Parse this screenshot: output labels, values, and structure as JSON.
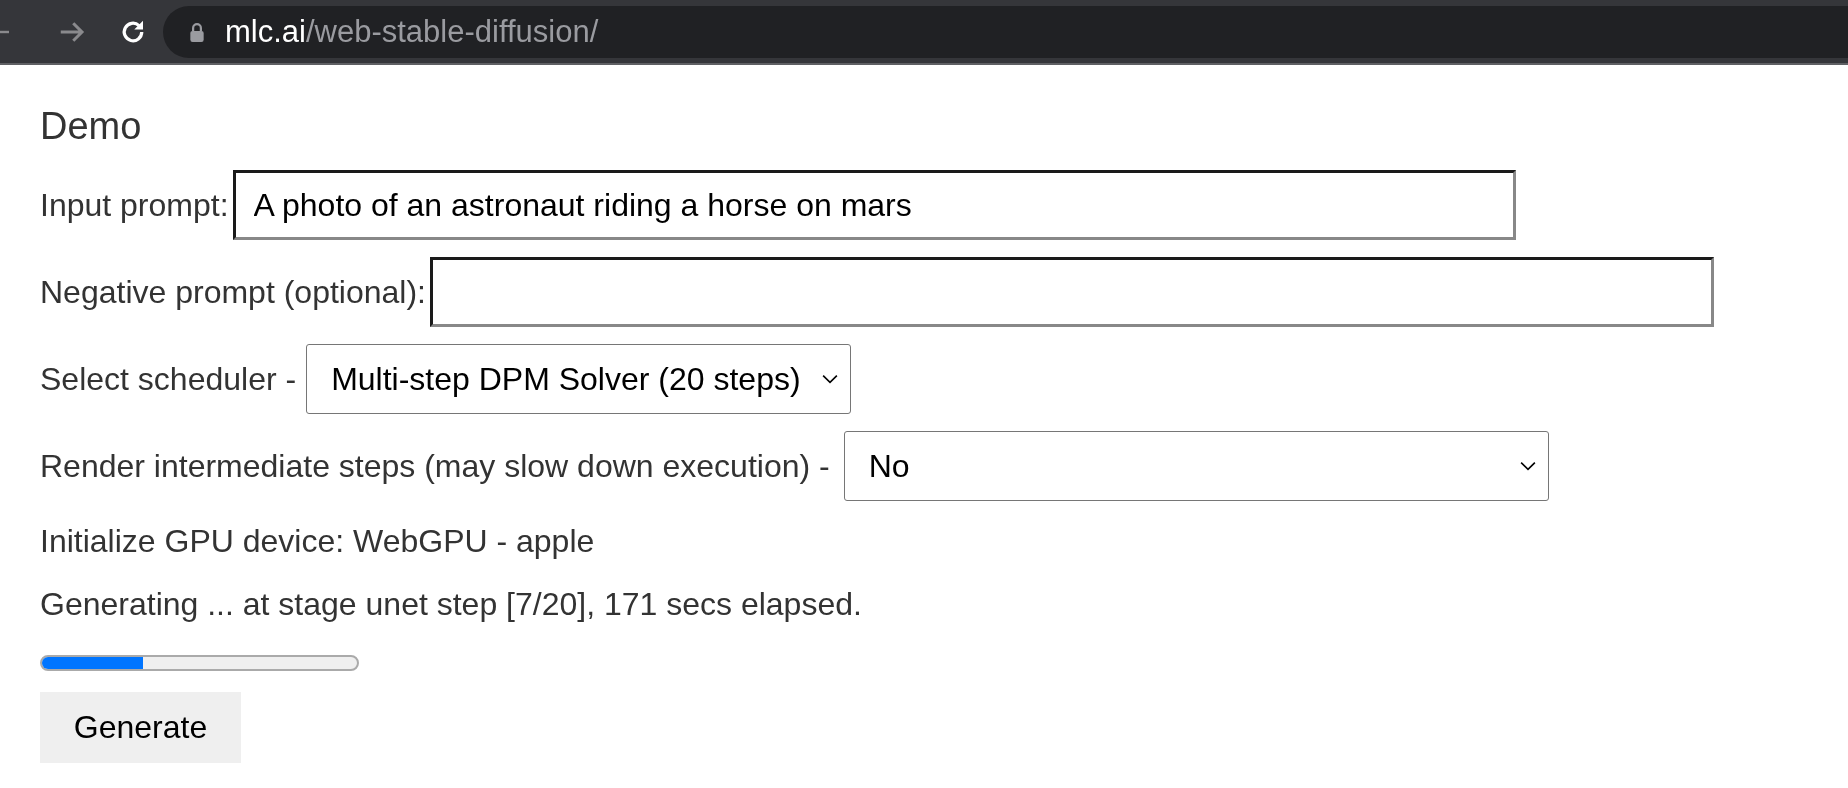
{
  "browser": {
    "url_host": "mlc.ai",
    "url_path": "/web-stable-diffusion/"
  },
  "heading": "Demo",
  "fields": [
    {
      "kind": "text",
      "label": "Input prompt:",
      "value": "A photo of an astronaut riding a horse on mars"
    },
    {
      "kind": "text",
      "label": "Negative prompt (optional):"
    },
    {
      "kind": "select",
      "label": "Select scheduler -",
      "value": "Multi-step DPM Solver (20 steps)"
    },
    {
      "kind": "select",
      "label": "Render intermediate steps (may slow down execution) -",
      "value": "No"
    }
  ],
  "status_lines": [
    "Initialize GPU device: WebGPU - apple",
    "Generating ... at stage unet step [7/20], 171 secs elapsed."
  ],
  "progress": {
    "level": 0.32
  },
  "button": "Generate"
}
